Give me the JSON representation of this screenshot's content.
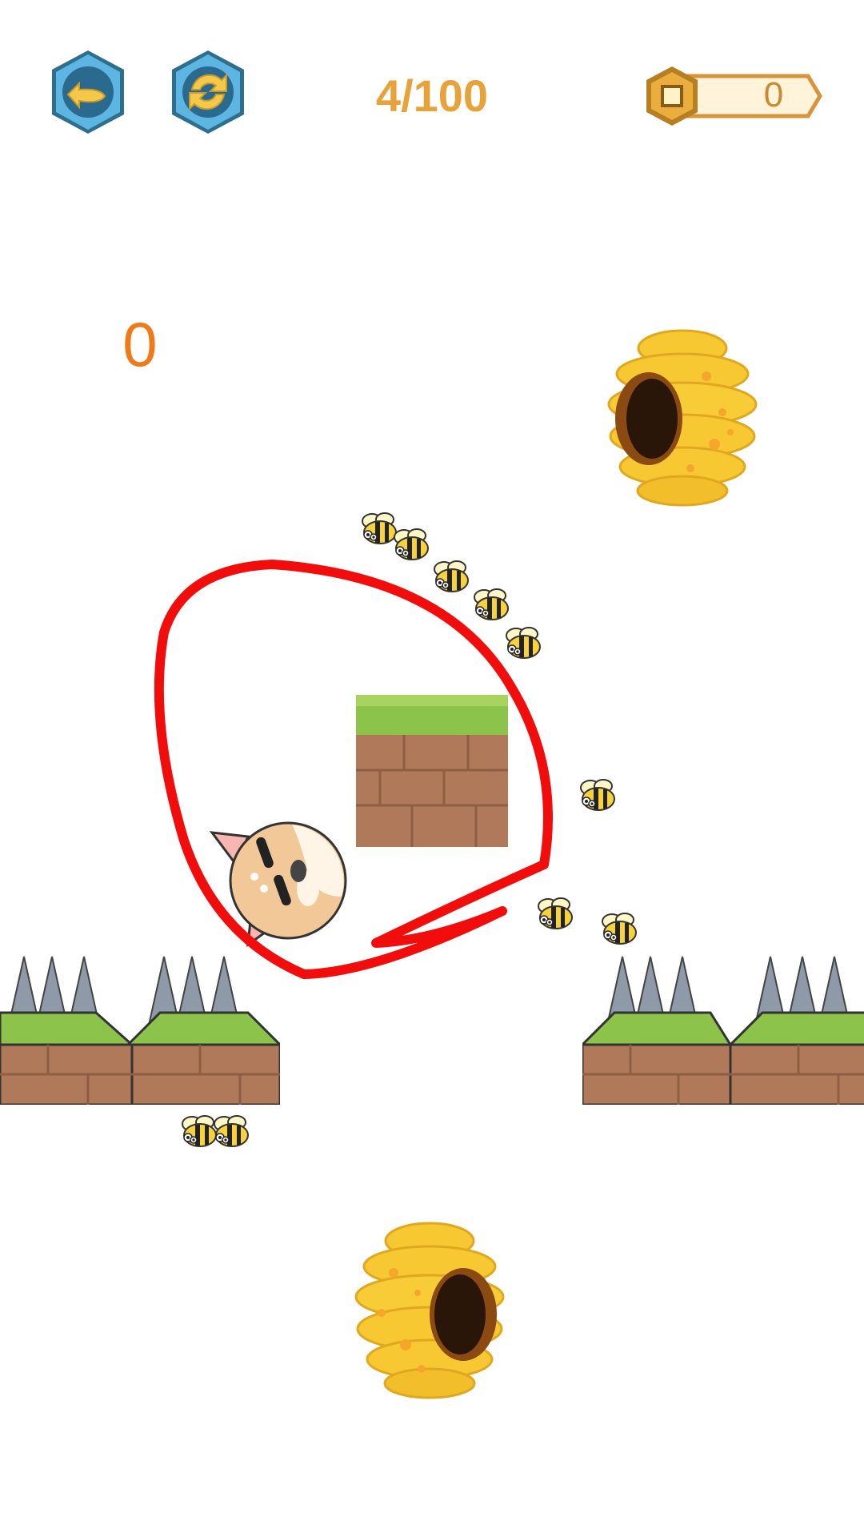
{
  "hud": {
    "back_button": "back-arrow-icon",
    "restart_button": "restart-icon",
    "level_label": "4/100",
    "coin_icon": "coin-icon",
    "coin_count": "0"
  },
  "game": {
    "score": "0",
    "drawn_line_color": "#F20D0D",
    "accent_colors": {
      "hud_text": "#E8A23A",
      "score": "#F07A19",
      "button_blue": "#4FA9D8",
      "honey": "#F7C832",
      "grass": "#8CC44B",
      "brick": "#B07A5A"
    }
  }
}
